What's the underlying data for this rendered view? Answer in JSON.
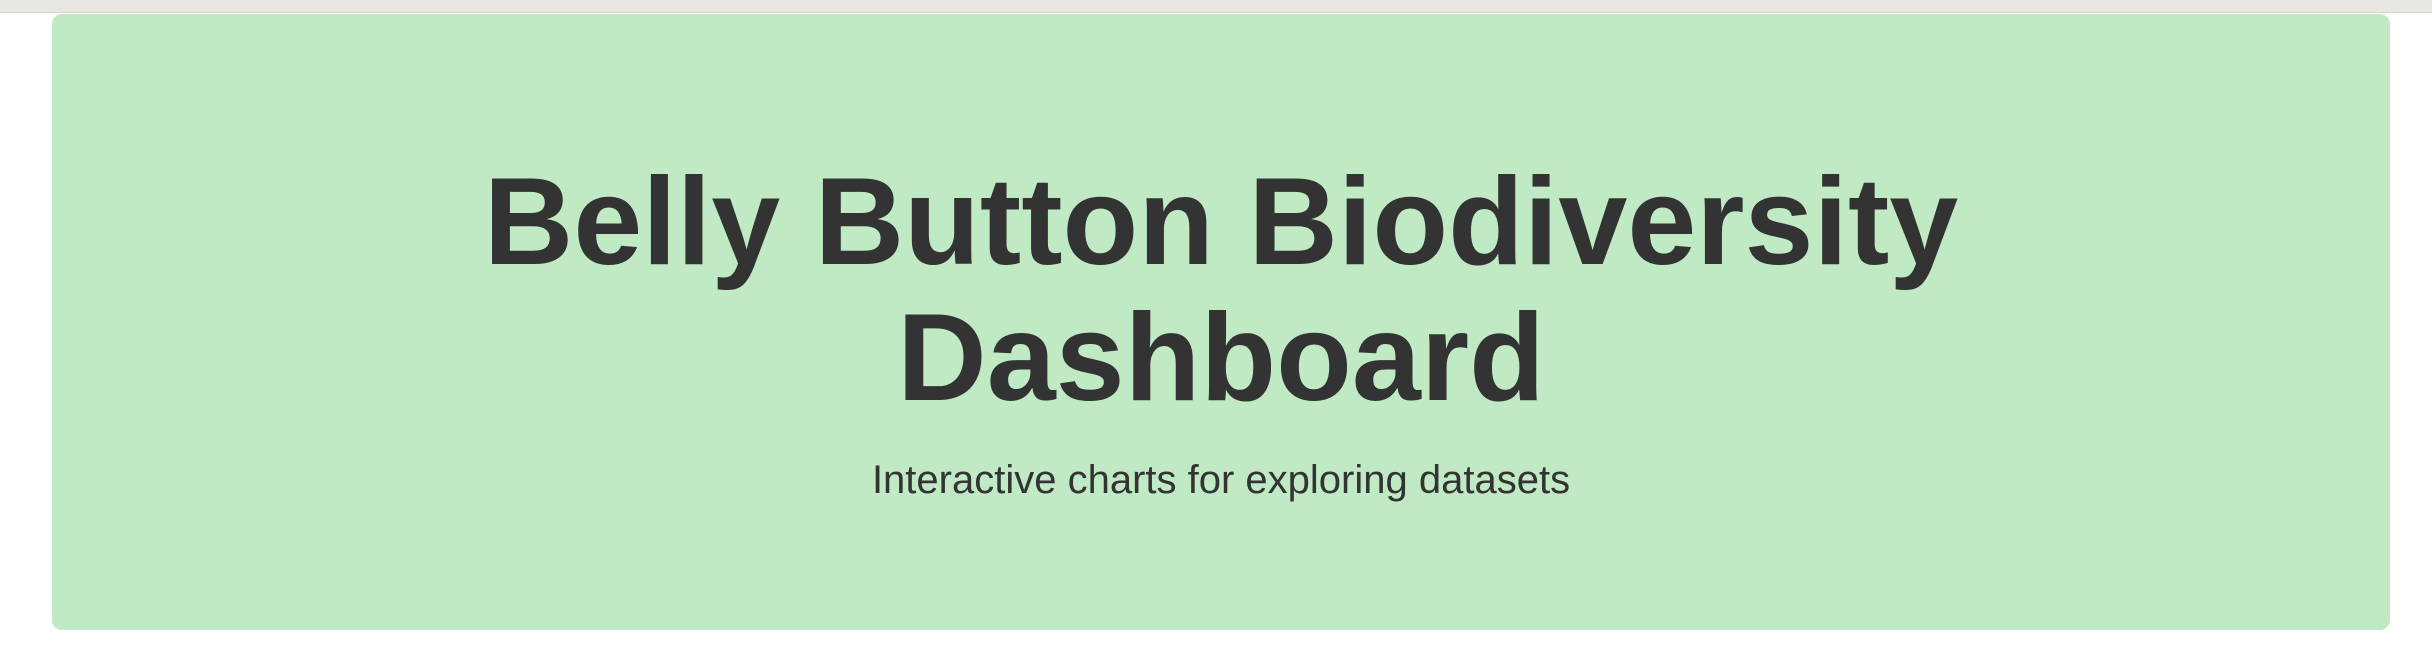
{
  "header": {
    "title": "Belly Button Biodiversity Dashboard",
    "subtitle": "Interactive charts for exploring datasets"
  },
  "colors": {
    "jumbotron_background": "#bfeac4",
    "text": "#333333",
    "browser_strip": "#e8e6e0"
  }
}
